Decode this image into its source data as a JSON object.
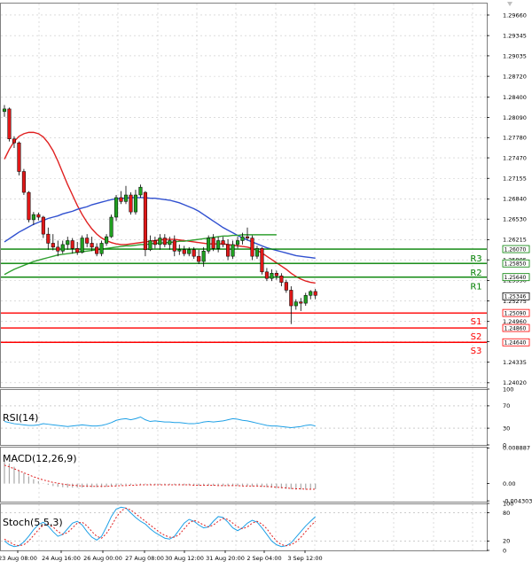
{
  "chart_data": [
    {
      "type": "candlestick",
      "panel": "price",
      "price_axis": {
        "ticks": [
          "1.29660",
          "1.29345",
          "1.29035",
          "1.28720",
          "1.28400",
          "1.28090",
          "1.27780",
          "1.27470",
          "1.27155",
          "1.26840",
          "1.26530",
          "1.26215",
          "1.25905",
          "1.25590",
          "1.25275",
          "1.24960",
          "1.24650",
          "1.24335",
          "1.24020"
        ],
        "ylim": [
          1.2395,
          1.2985
        ]
      },
      "time_axis": {
        "labels": [
          "23 Aug 08:00",
          "24 Aug 16:00",
          "26 Aug 00:00",
          "27 Aug 08:00",
          "30 Aug 12:00",
          "31 Aug 20:00",
          "2 Sep 04:00",
          "3 Sep 12:00"
        ]
      },
      "candles": [
        [
          1.2818,
          1.2828,
          1.281,
          1.2822
        ],
        [
          1.2822,
          1.2824,
          1.2772,
          1.2776
        ],
        [
          1.2776,
          1.278,
          1.2762,
          1.277
        ],
        [
          1.277,
          1.2772,
          1.272,
          1.2726
        ],
        [
          1.2726,
          1.273,
          1.269,
          1.2694
        ],
        [
          1.2694,
          1.2696,
          1.2648,
          1.2652
        ],
        [
          1.2652,
          1.2664,
          1.2644,
          1.266
        ],
        [
          1.266,
          1.2663,
          1.2651,
          1.2656
        ],
        [
          1.2656,
          1.2658,
          1.2624,
          1.263
        ],
        [
          1.263,
          1.264,
          1.2606,
          1.2616
        ],
        [
          1.2616,
          1.263,
          1.2605,
          1.261
        ],
        [
          1.261,
          1.262,
          1.2596,
          1.2604
        ],
        [
          1.2604,
          1.262,
          1.26,
          1.2614
        ],
        [
          1.2614,
          1.2626,
          1.2606,
          1.262
        ],
        [
          1.262,
          1.2624,
          1.26,
          1.2608
        ],
        [
          1.2608,
          1.2618,
          1.2598,
          1.2602
        ],
        [
          1.2602,
          1.2628,
          1.26,
          1.2624
        ],
        [
          1.2624,
          1.263,
          1.261,
          1.2616
        ],
        [
          1.2616,
          1.2626,
          1.2604,
          1.261
        ],
        [
          1.261,
          1.2616,
          1.2596,
          1.26
        ],
        [
          1.26,
          1.262,
          1.2596,
          1.2616
        ],
        [
          1.2616,
          1.263,
          1.2612,
          1.2626
        ],
        [
          1.2626,
          1.266,
          1.2624,
          1.2656
        ],
        [
          1.2656,
          1.269,
          1.265,
          1.2686
        ],
        [
          1.2686,
          1.2696,
          1.2676,
          1.268
        ],
        [
          1.268,
          1.2704,
          1.2676,
          1.269
        ],
        [
          1.269,
          1.2694,
          1.266,
          1.2664
        ],
        [
          1.2664,
          1.2698,
          1.266,
          1.269
        ],
        [
          1.269,
          1.2706,
          1.2686,
          1.2702
        ],
        [
          1.2694,
          1.2696,
          1.2596,
          1.2606
        ],
        [
          1.2606,
          1.2628,
          1.2604,
          1.262
        ],
        [
          1.262,
          1.2626,
          1.2608,
          1.2614
        ],
        [
          1.2614,
          1.263,
          1.2606,
          1.2624
        ],
        [
          1.2624,
          1.263,
          1.261,
          1.2614
        ],
        [
          1.2614,
          1.2626,
          1.2606,
          1.262
        ],
        [
          1.262,
          1.2628,
          1.2596,
          1.2604
        ],
        [
          1.2604,
          1.2614,
          1.2598,
          1.2606
        ],
        [
          1.2606,
          1.2612,
          1.2596,
          1.26
        ],
        [
          1.26,
          1.261,
          1.2596,
          1.2606
        ],
        [
          1.2606,
          1.261,
          1.2592,
          1.2596
        ],
        [
          1.2596,
          1.2606,
          1.2584,
          1.2588
        ],
        [
          1.2588,
          1.261,
          1.258,
          1.2604
        ],
        [
          1.2604,
          1.2628,
          1.26,
          1.2624
        ],
        [
          1.2624,
          1.263,
          1.2604,
          1.2608
        ],
        [
          1.2608,
          1.2626,
          1.2602,
          1.262
        ],
        [
          1.262,
          1.2626,
          1.261,
          1.2614
        ],
        [
          1.2614,
          1.2622,
          1.259,
          1.2596
        ],
        [
          1.2596,
          1.262,
          1.2592,
          1.2614
        ],
        [
          1.2614,
          1.2626,
          1.2608,
          1.262
        ],
        [
          1.262,
          1.2632,
          1.2614,
          1.2626
        ],
        [
          1.2626,
          1.264,
          1.262,
          1.2624
        ],
        [
          1.2624,
          1.2628,
          1.259,
          1.2596
        ],
        [
          1.2596,
          1.2612,
          1.2592,
          1.2608
        ],
        [
          1.2608,
          1.261,
          1.2568,
          1.2572
        ],
        [
          1.2572,
          1.2578,
          1.2558,
          1.2562
        ],
        [
          1.2562,
          1.2576,
          1.2558,
          1.257
        ],
        [
          1.257,
          1.2574,
          1.256,
          1.2566
        ],
        [
          1.2566,
          1.257,
          1.255,
          1.2556
        ],
        [
          1.2556,
          1.256,
          1.254,
          1.2544
        ],
        [
          1.2544,
          1.255,
          1.2492,
          1.252
        ],
        [
          1.252,
          1.253,
          1.2514,
          1.2526
        ],
        [
          1.2526,
          1.2532,
          1.2512,
          1.2524
        ],
        [
          1.2524,
          1.254,
          1.252,
          1.2536
        ],
        [
          1.2536,
          1.2544,
          1.253,
          1.2542
        ],
        [
          1.2542,
          1.2546,
          1.253,
          1.2536
        ]
      ],
      "moving_averages": [
        {
          "color": "#e02020",
          "values": [
            1.2745,
            1.276,
            1.2772,
            1.278,
            1.2784,
            1.2786,
            1.2786,
            1.2784,
            1.2779,
            1.277,
            1.2758,
            1.2742,
            1.2724,
            1.2706,
            1.269,
            1.2674,
            1.266,
            1.2648,
            1.2638,
            1.263,
            1.2624,
            1.262,
            1.2617,
            1.2615,
            1.2614,
            1.2614,
            1.2615,
            1.2616,
            1.2617,
            1.2618,
            1.2619,
            1.262,
            1.2621,
            1.2622,
            1.2622,
            1.2622,
            1.2621,
            1.262,
            1.2619,
            1.2618,
            1.2617,
            1.2616,
            1.2615,
            1.2615,
            1.2615,
            1.2615,
            1.2614,
            1.2613,
            1.2612,
            1.2611,
            1.261,
            1.2608,
            1.2605,
            1.2601,
            1.2596,
            1.2591,
            1.2586,
            1.2581,
            1.2576,
            1.257,
            1.2565,
            1.2561,
            1.2558,
            1.2556,
            1.2555
          ]
        },
        {
          "color": "#3050d0",
          "values": [
            1.2618,
            1.2623,
            1.2628,
            1.2633,
            1.2637,
            1.2641,
            1.2645,
            1.2648,
            1.2651,
            1.2654,
            1.2656,
            1.2658,
            1.2661,
            1.2663,
            1.2665,
            1.2668,
            1.267,
            1.2672,
            1.2675,
            1.2677,
            1.2679,
            1.2681,
            1.2683,
            1.2684,
            1.2685,
            1.2685,
            1.2686,
            1.2686,
            1.2686,
            1.2686,
            1.2685,
            1.2685,
            1.2684,
            1.2683,
            1.2682,
            1.268,
            1.2678,
            1.2675,
            1.2672,
            1.2669,
            1.2665,
            1.266,
            1.2655,
            1.265,
            1.2645,
            1.264,
            1.2636,
            1.2632,
            1.2628,
            1.2624,
            1.2621,
            1.2618,
            1.2615,
            1.2612,
            1.2609,
            1.2607,
            1.2605,
            1.2603,
            1.2601,
            1.2599,
            1.2597,
            1.2596,
            1.2595,
            1.2594,
            1.2593
          ]
        },
        {
          "color": "#30a030",
          "values": [
            1.2568,
            1.2572,
            1.2576,
            1.2579,
            1.2582,
            1.2585,
            1.2588,
            1.259,
            1.2592,
            1.2594,
            1.2596,
            1.2598,
            1.2599,
            1.26,
            1.2601,
            1.2602,
            1.2603,
            1.2604,
            1.2605,
            1.2606,
            1.2607,
            1.2608,
            1.2609,
            1.261,
            1.2611,
            1.2612,
            1.2612,
            1.2613,
            1.2614,
            1.2614,
            1.2615,
            1.2616,
            1.2616,
            1.2617,
            1.2617,
            1.2618,
            1.2619,
            1.2619,
            1.262,
            1.2621,
            1.2622,
            1.2623,
            1.2624,
            1.2625,
            1.2626,
            1.2627,
            1.2627,
            1.2628,
            1.2628,
            1.2629,
            1.2629,
            1.2629,
            1.2629,
            1.2629,
            1.2629,
            1.2629,
            1.2629
          ]
        }
      ],
      "levels": [
        {
          "name": "R3",
          "price": 1.2607,
          "color": "#008000"
        },
        {
          "name": "R2",
          "price": 1.2585,
          "color": "#008000"
        },
        {
          "name": "R1",
          "price": 1.2564,
          "color": "#008000"
        },
        {
          "name": "S1",
          "price": 1.2509,
          "color": "#ff0000"
        },
        {
          "name": "S2",
          "price": 1.2486,
          "color": "#ff0000"
        },
        {
          "name": "S3",
          "price": 1.2464,
          "color": "#ff0000"
        }
      ],
      "current_price": "1.25346",
      "level_tags": [
        "1.26070",
        "1.25850",
        "1.25640",
        "1.25090",
        "1.24860",
        "1.24640"
      ]
    },
    {
      "type": "line",
      "panel": "rsi",
      "title": "RSI(14)",
      "ticks": [
        "100",
        "70",
        "30",
        "0"
      ],
      "ylim": [
        0,
        100
      ],
      "values": [
        42,
        40,
        38,
        37,
        36,
        35,
        35,
        36,
        38,
        37,
        36,
        35,
        34,
        33,
        34,
        35,
        36,
        35,
        34,
        34,
        35,
        37,
        40,
        44,
        46,
        47,
        45,
        47,
        50,
        45,
        42,
        43,
        42,
        41,
        41,
        40,
        40,
        39,
        38,
        38,
        39,
        41,
        42,
        41,
        42,
        43,
        45,
        47,
        46,
        44,
        43,
        41,
        39,
        37,
        35,
        34,
        34,
        33,
        32,
        31,
        32,
        33,
        35,
        36,
        34
      ]
    },
    {
      "type": "histogram",
      "panel": "macd",
      "title": "MACD(12,26,9)",
      "ticks": [
        "0.008887",
        "0.00",
        "-0.004303"
      ],
      "ylim": [
        -0.0045,
        0.0092
      ],
      "histogram": [
        0.0058,
        0.005,
        0.0042,
        0.0034,
        0.0026,
        0.0018,
        0.0011,
        0.0006,
        0.0001,
        -0.0003,
        -0.0006,
        -0.0008,
        -0.0009,
        -0.001,
        -0.001,
        -0.001,
        -0.001,
        -0.0009,
        -0.0009,
        -0.0009,
        -0.0009,
        -0.0008,
        -0.0007,
        -0.0006,
        -0.0004,
        -0.0003,
        -0.0003,
        -0.0002,
        -0.0002,
        -0.0002,
        -0.0002,
        -0.0003,
        -0.0003,
        -0.0003,
        -0.0003,
        -0.0003,
        -0.0003,
        -0.0004,
        -0.0004,
        -0.0004,
        -0.0005,
        -0.0005,
        -0.0005,
        -0.0005,
        -0.0005,
        -0.0006,
        -0.0006,
        -0.0006,
        -0.0006,
        -0.0006,
        -0.0006,
        -0.0007,
        -0.0007,
        -0.0008,
        -0.0009,
        -0.001,
        -0.0011,
        -0.0012,
        -0.0013,
        -0.0014,
        -0.0015,
        -0.0015,
        -0.0015,
        -0.0015,
        -0.0014
      ],
      "signal": [
        0.0046,
        0.0042,
        0.0037,
        0.0032,
        0.0027,
        0.0022,
        0.0017,
        0.0013,
        0.0009,
        0.0006,
        0.0003,
        0.0001,
        -0.0001,
        -0.0003,
        -0.0004,
        -0.0005,
        -0.0006,
        -0.0006,
        -0.0007,
        -0.0007,
        -0.0007,
        -0.0007,
        -0.0006,
        -0.0006,
        -0.0005,
        -0.0005,
        -0.0004,
        -0.0004,
        -0.0003,
        -0.0003,
        -0.0003,
        -0.0003,
        -0.0003,
        -0.0003,
        -0.0003,
        -0.0003,
        -0.0003,
        -0.0003,
        -0.0003,
        -0.0004,
        -0.0004,
        -0.0004,
        -0.0004,
        -0.0004,
        -0.0005,
        -0.0005,
        -0.0005,
        -0.0005,
        -0.0005,
        -0.0006,
        -0.0006,
        -0.0006,
        -0.0006,
        -0.0007,
        -0.0007,
        -0.0008,
        -0.0009,
        -0.001,
        -0.0011,
        -0.0012,
        -0.0013,
        -0.0013,
        -0.0014,
        -0.0014,
        -0.0014
      ]
    },
    {
      "type": "line",
      "panel": "stochastic",
      "title": "Stoch(5,5,3)",
      "ticks": [
        "100",
        "80",
        "20",
        "0"
      ],
      "ylim": [
        0,
        100
      ],
      "main": [
        20,
        12,
        8,
        10,
        18,
        30,
        44,
        55,
        60,
        52,
        40,
        30,
        34,
        46,
        58,
        62,
        54,
        40,
        28,
        22,
        30,
        50,
        72,
        88,
        92,
        90,
        80,
        70,
        62,
        56,
        46,
        38,
        32,
        26,
        24,
        30,
        44,
        58,
        66,
        62,
        54,
        48,
        50,
        62,
        72,
        70,
        60,
        48,
        42,
        48,
        58,
        64,
        60,
        48,
        34,
        20,
        12,
        8,
        10,
        16,
        28,
        40,
        52,
        62,
        72
      ],
      "signal": [
        24,
        18,
        12,
        10,
        12,
        20,
        32,
        44,
        54,
        56,
        50,
        40,
        34,
        38,
        48,
        58,
        60,
        52,
        40,
        30,
        26,
        36,
        52,
        70,
        84,
        90,
        86,
        78,
        70,
        62,
        54,
        46,
        38,
        32,
        28,
        28,
        34,
        46,
        58,
        64,
        60,
        54,
        50,
        54,
        62,
        68,
        66,
        58,
        50,
        46,
        50,
        58,
        62,
        56,
        46,
        32,
        20,
        12,
        10,
        12,
        18,
        28,
        40,
        52,
        62
      ]
    }
  ]
}
